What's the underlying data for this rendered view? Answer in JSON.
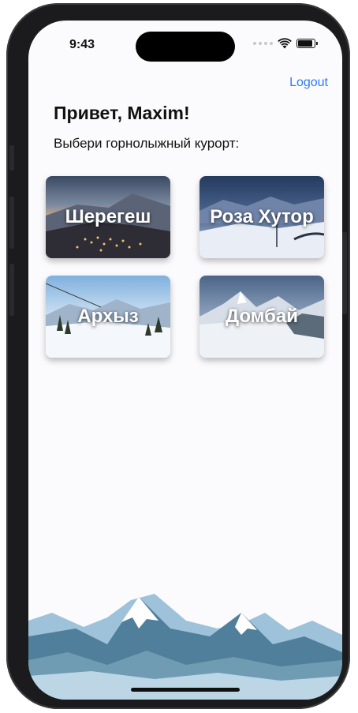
{
  "status_bar": {
    "time": "9:43"
  },
  "header": {
    "logout_label": "Logout"
  },
  "main": {
    "greeting": "Привет, Maxim!",
    "prompt": "Выбери горнолыжный курорт:",
    "resorts": [
      {
        "name": "Шерегеш"
      },
      {
        "name": "Роза Хутор"
      },
      {
        "name": "Архыз"
      },
      {
        "name": "Домбай"
      }
    ]
  },
  "colors": {
    "accent": "#2f7cf6",
    "text": "#111111",
    "background": "#fbfbfd"
  }
}
